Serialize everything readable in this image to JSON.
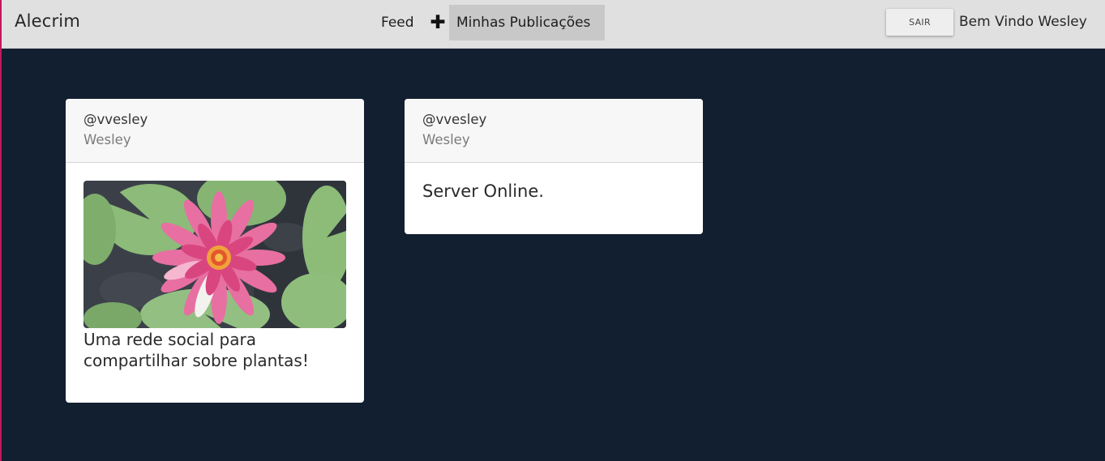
{
  "navbar": {
    "brand": "Alecrim",
    "links": {
      "feed": "Feed",
      "new_post": "✚",
      "my_posts": "Minhas Publicações"
    },
    "logout_label": "SAIR",
    "welcome": "Bem Vindo Wesley"
  },
  "posts": [
    {
      "handle": "@vvesley",
      "name": "Wesley",
      "image": "pink-water-lily-photo",
      "text": "Uma rede social para compartilhar sobre plantas!"
    },
    {
      "handle": "@vvesley",
      "name": "Wesley",
      "text": "Server Online."
    }
  ],
  "colors": {
    "page_background": "#121f30",
    "navbar_background": "#e0e0e0",
    "active_nav": "#c8c8c8",
    "card_header": "#f7f7f7",
    "card_body": "#ffffff"
  }
}
